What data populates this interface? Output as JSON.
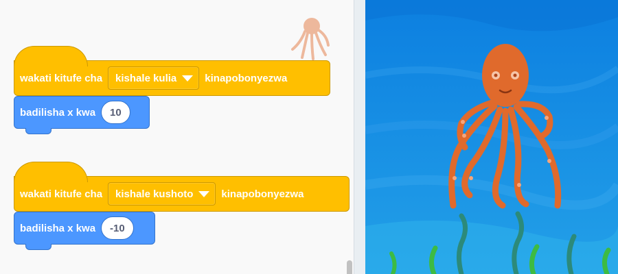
{
  "scripts": [
    {
      "hat_prefix": "wakati kitufe cha",
      "key": "kishale kulia",
      "hat_suffix": "kinapobonyezwa",
      "motion_label": "badilisha x kwa",
      "motion_value": "10"
    },
    {
      "hat_prefix": "wakati kitufe cha",
      "key": "kishale kushoto",
      "hat_suffix": "kinapobonyezwa",
      "motion_label": "badilisha x kwa",
      "motion_value": "-10"
    }
  ],
  "colors": {
    "events_block": "#ffbf00",
    "motion_block": "#4c97ff",
    "stage_water": "#1a8ae6",
    "octopus": "#e06a2c"
  },
  "icons": {
    "sprite_thumbnail": "octopus-icon",
    "dropdown": "chevron-down-icon"
  }
}
